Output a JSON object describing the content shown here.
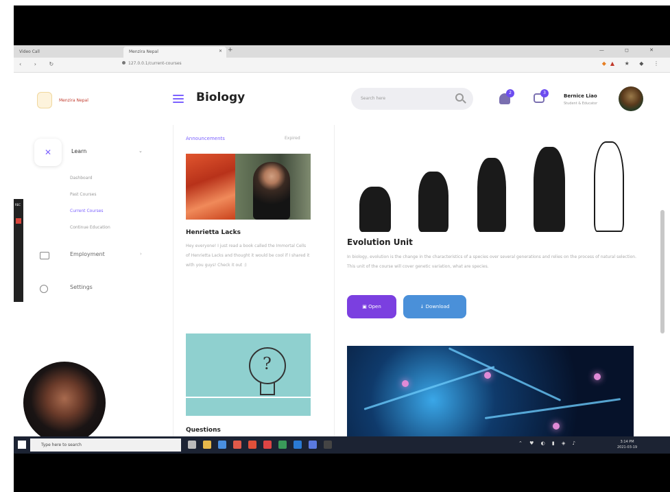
{
  "browser": {
    "tabs": [
      {
        "label": "Video Call"
      },
      {
        "label": "Menzira Nepal"
      }
    ],
    "url": "127.0.0.1/current-courses",
    "window_controls": "— ◻ ✕"
  },
  "app": {
    "brand": "Menzira Nepal",
    "page_title": "Biology",
    "search_placeholder": "Search here",
    "notifications_count": "2",
    "messages_count": "3",
    "user": {
      "name": "Bernice Liao",
      "role": "Student & Educator"
    }
  },
  "sidebar": {
    "learn_label": "Learn",
    "sub_items": [
      "Dashboard",
      "Past Courses",
      "Current Courses",
      "Continue Education"
    ],
    "active_sub": "Current Courses",
    "employment_label": "Employment",
    "settings_label": "Settings",
    "rec_label": "REC"
  },
  "feed": {
    "tab_announcements": "Announcements",
    "tab_expired": "Expired",
    "post_title": "Henrietta Lacks",
    "post_body": "Hey everyone! I just read a book called the Immortal Cells of Henrietta Lacks and thought it would be cool if I shared it with you guys! Check it out :)",
    "questions_title": "Questions"
  },
  "unit": {
    "title": "Evolution Unit",
    "description": "In biology, evolution is the change in the characteristics of a species over several generations and relies on the process of natural selection. This unit of the course will cover genetic variation, what are species.",
    "open_label": "Open",
    "download_label": "Download"
  },
  "taskbar": {
    "search_text": "Type here to search",
    "time": "3:14 PM",
    "date": "2021-03-19"
  },
  "colors": {
    "accent": "#7b61ff",
    "open_button": "#7b3fe0",
    "download_button": "#4a90d9",
    "taskbar": "#1c2333"
  },
  "icons": [
    "menu-icon",
    "search-icon",
    "bell-icon",
    "chat-icon",
    "learn-icon",
    "employment-icon",
    "settings-icon",
    "windows-icon"
  ]
}
